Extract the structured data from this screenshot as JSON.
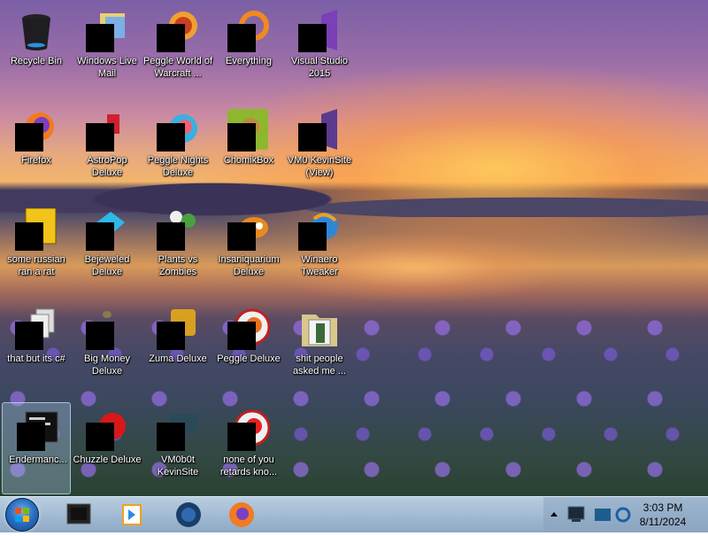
{
  "desktop": {
    "icons": [
      {
        "label": "Recycle Bin",
        "icon": "recycle-bin-icon",
        "redacted": false
      },
      {
        "label": "Windows Live Mail",
        "icon": "mail-icon",
        "redacted": true
      },
      {
        "label": "Peggle World of Warcraft ...",
        "icon": "peggle-icon",
        "redacted": true
      },
      {
        "label": "Everything",
        "icon": "everything-search-icon",
        "redacted": true
      },
      {
        "label": "Visual Studio 2015",
        "icon": "visual-studio-icon",
        "redacted": true
      },
      {
        "label": "Firefox",
        "icon": "firefox-icon",
        "redacted": true
      },
      {
        "label": "AstroPop Deluxe",
        "icon": "astropop-icon",
        "redacted": true
      },
      {
        "label": "Peggle Nights Deluxe",
        "icon": "peggle-nights-icon",
        "redacted": true
      },
      {
        "label": "ChomikBox",
        "icon": "chomikbox-icon",
        "redacted": true
      },
      {
        "label": "VM0 KevinSite (View)",
        "icon": "visual-studio-icon",
        "redacted": true
      },
      {
        "label": "some russian ran a rat",
        "icon": "document-icon",
        "redacted": true
      },
      {
        "label": "Bejeweled Deluxe",
        "icon": "bejeweled-icon",
        "redacted": true
      },
      {
        "label": "Plants vs Zombies",
        "icon": "plants-vs-zombies-icon",
        "redacted": true
      },
      {
        "label": "Insaniquarium Deluxe",
        "icon": "insaniquarium-icon",
        "redacted": true
      },
      {
        "label": "Winaero Tweaker",
        "icon": "winaero-tweaker-icon",
        "redacted": true
      },
      {
        "label": "that but its c#",
        "icon": "copy-icon",
        "redacted": true
      },
      {
        "label": "Big Money Deluxe",
        "icon": "big-money-icon",
        "redacted": true
      },
      {
        "label": "Zuma Deluxe",
        "icon": "zuma-icon",
        "redacted": true
      },
      {
        "label": "Peggle Deluxe",
        "icon": "peggle-icon",
        "redacted": false
      },
      {
        "label": "shit people asked me ...",
        "icon": "folder-icon",
        "redacted": false
      },
      {
        "label": "Endermanc...",
        "icon": "terminal-icon",
        "redacted": true,
        "selected": true
      },
      {
        "label": "Chuzzle Deluxe",
        "icon": "chuzzle-icon",
        "redacted": true
      },
      {
        "label": "VM0b0t KevinSite",
        "icon": "vm-icon",
        "redacted": true
      },
      {
        "label": "none of you retards kno...",
        "icon": "peggle-icon",
        "redacted": true
      }
    ]
  },
  "taskbar": {
    "pinned": [
      {
        "name": "explorer-taskbar-icon"
      },
      {
        "name": "media-player-taskbar-icon"
      },
      {
        "name": "globe-taskbar-icon"
      },
      {
        "name": "firefox-taskbar-icon"
      }
    ],
    "clock": {
      "time": "3:03 PM",
      "date": "8/11/2024"
    }
  }
}
